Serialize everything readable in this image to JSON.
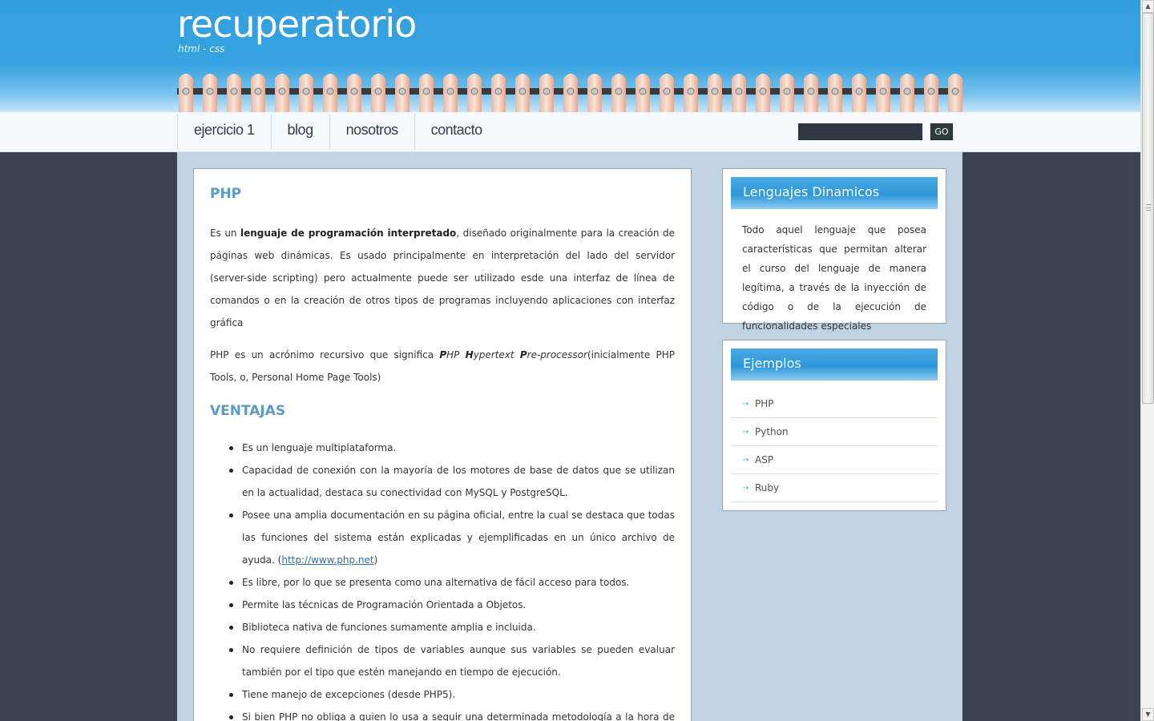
{
  "header": {
    "title": "recuperatorio",
    "tagline": "html - css"
  },
  "nav": {
    "items": [
      {
        "label": "ejercicio 1"
      },
      {
        "label": "blog"
      },
      {
        "label": "nosotros"
      },
      {
        "label": "contacto"
      }
    ],
    "search": {
      "value": "",
      "button_label": "GO"
    }
  },
  "main": {
    "heading": "PHP",
    "intro": {
      "pre": "Es un ",
      "bold": "lenguaje de programación interpretado",
      "post": ", diseñado originalmente para la creación de páginas web dinámicas. Es usado principalmente en interpretación del lado del servidor (server-side scripting) pero actualmente puede ser utilizado esde una interfaz de línea de comandos o en la creación de otros tipos de programas incluyendo aplicaciones con interfaz gráfica"
    },
    "acronym": {
      "pre": "PHP es un acrónimo recursivo que significa ",
      "p1": "P",
      "p2": "HP ",
      "h1": "H",
      "h2": "ypertext ",
      "pp1": "P",
      "pp2": "re-processor",
      "post": "(inicialmente PHP Tools, o, Personal Home Page Tools)"
    },
    "advantages_heading": "VENTAJAS",
    "advantages": [
      "Es un lenguaje multiplataforma.",
      "Capacidad de conexión con la mayoría de los motores de base de datos que se utilizan en la actualidad, destaca su conectividad con MySQL y PostgreSQL.",
      "Posee una amplia documentación en su página oficial, entre la cual se destaca que todas las funciones del sistema están explicadas y ejemplificadas en un único archivo de ayuda. (",
      "http://www.php.net",
      ")",
      "Es libre, por lo que se presenta como una alternativa de fácil acceso para todos.",
      "Permite las técnicas de Programación Orientada a Objetos.",
      "Biblioteca nativa de funciones sumamente amplia e incluida.",
      "No requiere definición de tipos de variables aunque sus variables se pueden evaluar también por el tipo que estén manejando en tiempo de ejecución.",
      "Tiene manejo de excepciones (desde PHP5).",
      "Si bien PHP no obliga a quien lo usa a seguir una determinada metodología a la hora de programar (muchos otros lenguajes tampoco lo hacen), aun estando dirigido a alguna en"
    ]
  },
  "sidebar": {
    "dynamic": {
      "title": "Lenguajes Dinamicos",
      "text": "Todo aquel lenguaje que posea características que permitan alterar el curso del lenguaje de manera legítima, a través de la inyección de código o de la ejecución de funcionalidades especiales"
    },
    "examples": {
      "title": "Ejemplos",
      "items": [
        "PHP",
        "Python",
        "ASP",
        "Ruby"
      ]
    }
  },
  "colors": {
    "header_blue": "#33a0de",
    "heading_blue": "#5b9bc6",
    "page_bg": "#3b4250",
    "wrap_bg": "#bfd3e1"
  },
  "icons": {
    "list_arrow": "arrow-right-icon",
    "scroll_up": "scroll-up-icon",
    "scroll_down": "scroll-down-icon"
  }
}
